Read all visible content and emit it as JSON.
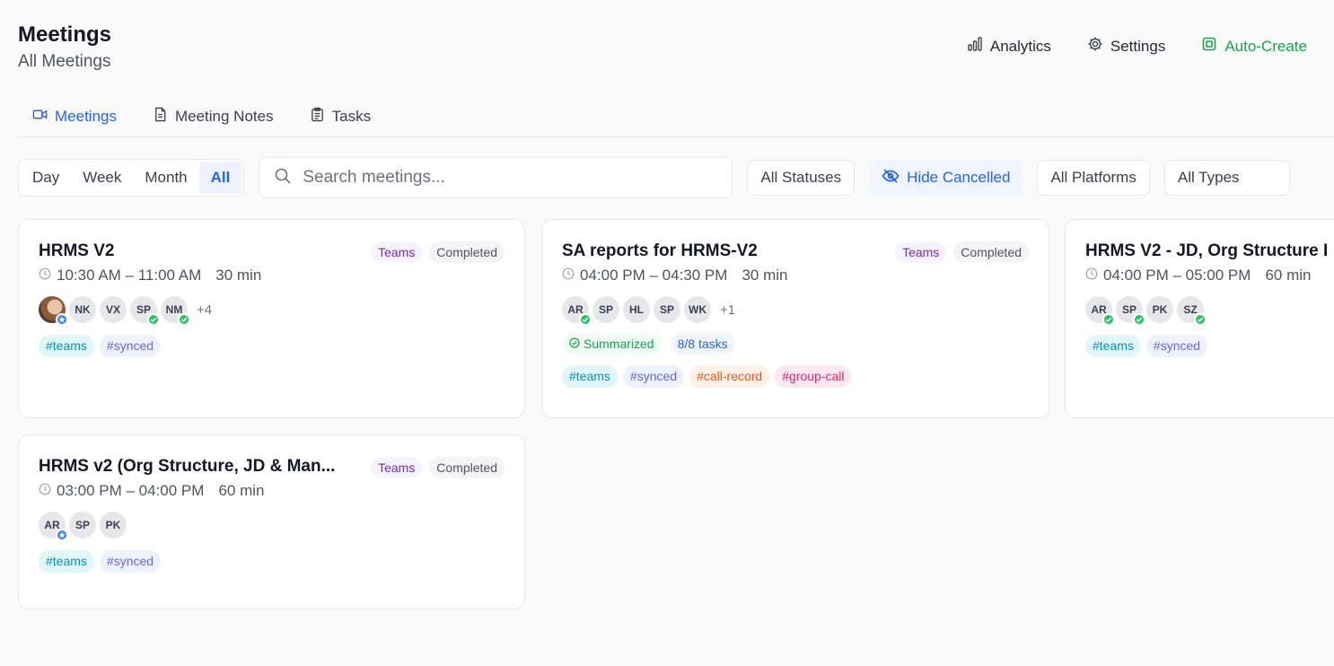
{
  "header": {
    "title": "Meetings",
    "subtitle": "All Meetings",
    "analytics_label": "Analytics",
    "settings_label": "Settings",
    "auto_create_label": "Auto-Create"
  },
  "tabs": [
    {
      "label": "Meetings",
      "icon": "video-icon",
      "active": true
    },
    {
      "label": "Meeting Notes",
      "icon": "document-icon",
      "active": false
    },
    {
      "label": "Tasks",
      "icon": "clipboard-icon",
      "active": false
    }
  ],
  "filters": {
    "ranges": [
      "Day",
      "Week",
      "Month",
      "All"
    ],
    "active_range": "All",
    "search_placeholder": "Search meetings...",
    "status_select": "All Statuses",
    "hide_cancelled": "Hide Cancelled",
    "platform_select": "All Platforms",
    "type_select": "All Types"
  },
  "colors": {
    "accent": "#2563eb",
    "green": "#16a34a",
    "teams_purple": "#7e22ce"
  },
  "meetings": [
    {
      "title": "HRMS V2",
      "platform": "Teams",
      "status": "Completed",
      "time": "10:30 AM – 11:00 AM",
      "duration": "30 min",
      "attendees": [
        {
          "initials": "",
          "photo": true,
          "mark": "star"
        },
        {
          "initials": "NK",
          "mark": ""
        },
        {
          "initials": "VX",
          "mark": ""
        },
        {
          "initials": "SP",
          "mark": "check"
        },
        {
          "initials": "NM",
          "mark": "check"
        }
      ],
      "more": "+4",
      "tags": [
        "#teams",
        "#synced"
      ]
    },
    {
      "title": "SA reports for HRMS-V2",
      "platform": "Teams",
      "status": "Completed",
      "time": "04:00 PM – 04:30 PM",
      "duration": "30 min",
      "attendees": [
        {
          "initials": "AR",
          "mark": "check"
        },
        {
          "initials": "SP",
          "mark": ""
        },
        {
          "initials": "HL",
          "mark": ""
        },
        {
          "initials": "SP",
          "mark": ""
        },
        {
          "initials": "WK",
          "mark": ""
        }
      ],
      "more": "+1",
      "summary_label": "Summarized",
      "tasks_label": "8/8 tasks",
      "tags": [
        "#teams",
        "#synced",
        "#call-record",
        "#group-call"
      ]
    },
    {
      "title": "HRMS V2 - JD, Org Structure I",
      "platform": "",
      "status": "",
      "time": "04:00 PM – 05:00 PM",
      "duration": "60 min",
      "attendees": [
        {
          "initials": "AR",
          "mark": "check"
        },
        {
          "initials": "SP",
          "mark": "check"
        },
        {
          "initials": "PK",
          "mark": ""
        },
        {
          "initials": "SZ",
          "mark": "check"
        }
      ],
      "more": "",
      "tags": [
        "#teams",
        "#synced"
      ]
    },
    {
      "title": "HRMS v2 (Org Structure, JD & Man...",
      "platform": "Teams",
      "status": "Completed",
      "time": "03:00 PM – 04:00 PM",
      "duration": "60 min",
      "attendees": [
        {
          "initials": "AR",
          "mark": "star"
        },
        {
          "initials": "SP",
          "mark": ""
        },
        {
          "initials": "PK",
          "mark": ""
        }
      ],
      "more": "",
      "tags": [
        "#teams",
        "#synced"
      ]
    }
  ]
}
